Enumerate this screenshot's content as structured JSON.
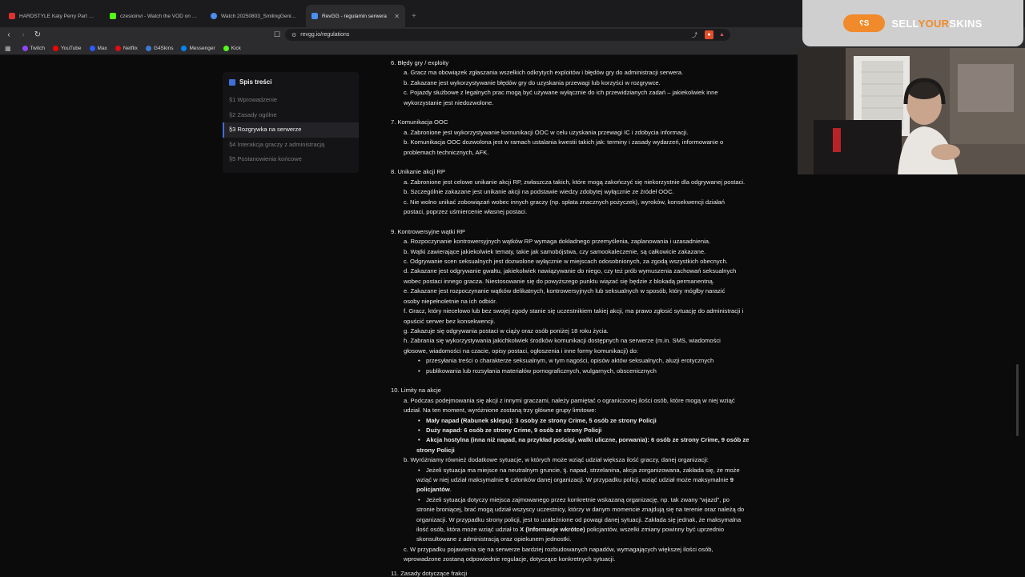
{
  "tabs": [
    {
      "title": "HARDSTYLE Katy Perry Part Of M",
      "color": "#e0302d"
    },
    {
      "title": "czesioinvi - Watch the VOD on Kick",
      "color": "#53fc18"
    },
    {
      "title": "Watch 20250803_SmilingGeniusGarl",
      "color": "#4a8ef0"
    },
    {
      "title": "RevGG - regulamin serwera",
      "color": "#4a8ef0"
    }
  ],
  "url": "revgg.io/regulations",
  "bookmarks": [
    {
      "label": "Twitch",
      "color": "#9146ff"
    },
    {
      "label": "YouTube",
      "color": "#ff0000"
    },
    {
      "label": "Max",
      "color": "#2d5bff"
    },
    {
      "label": "Netflix",
      "color": "#e50914"
    },
    {
      "label": "G4Skins",
      "color": "#3a7bd5"
    },
    {
      "label": "Messenger",
      "color": "#0084ff"
    },
    {
      "label": "Kick",
      "color": "#53fc18"
    }
  ],
  "toc": {
    "title": "Spis treści",
    "items": [
      "§1 Wprowadzenie",
      "§2 Zasady ogólne",
      "§3 Rozgrywka na serwerze",
      "§4 Interakcja graczy z administracją",
      "§5 Postanowienia końcowe"
    ],
    "active_index": 2
  },
  "content": {
    "s6": {
      "title": "6. Błędy gry / exploity",
      "a": "a. Gracz ma obowiązek zgłaszania wszelkich odkrytych exploitów i błędów gry do administracji serwera.",
      "b": "b. Zakazane jest wykorzystywanie błędów gry do uzyskania przewagi lub korzyści w rozgrywce.",
      "c1": "c. Pojazdy służbowe z legalnych prac mogą być używane wyłącznie do ich przewidzianych zadań – jakiekolwiek inne",
      "c2": "wykorzystanie jest niedozwolone."
    },
    "s7": {
      "title": "7. Komunikacja OOC",
      "a": "a. Zabronione jest wykorzystywanie komunikacji OOC w celu uzyskania przewagi IC i zdobycia informacji.",
      "b1": "b. Komunikacja OOC dozwolona jest w ramach ustalania kwestii takich jak: terminy i zasady wydarzeń, informowanie o",
      "b2": "problemach technicznych, AFK."
    },
    "s8": {
      "title": "8. Unikanie akcji RP",
      "a": "a. Zabronione jest celowe unikanie akcji RP, zwłaszcza takich, które mogą zakończyć się niekorzystnie dla odgrywanej postaci.",
      "b": "b. Szczególnie zakazane jest unikanie akcji na podstawie wiedzy zdobytej wyłącznie ze źródeł OOC.",
      "c1": "c. Nie wolno unikać zobowiązań wobec innych graczy (np. spłata znacznych pożyczek), wyroków, konsekwencji działań",
      "c2": "postaci, poprzez uśmiercenie własnej postaci."
    },
    "s9": {
      "title": "9. Kontrowersyjne wątki RP",
      "a": "a. Rozpoczynanie kontrowersyjnych wątków RP wymaga dokładnego przemyślenia, zaplanowania i uzasadnienia.",
      "b": "b. Wątki zawierające jakiekolwiek tematy, takie jak samobójstwa, czy samookaleczenie, są całkowicie zakazane.",
      "c": "c. Odgrywanie scen seksualnych jest dozwolone wyłącznie w miejscach odosobnionych, za zgodą wszystkich obecnych.",
      "d1": "d. Zakazane jest odgrywanie gwałtu, jakiekolwiek nawiązywanie do niego, czy też prób wymuszenia zachowań seksualnych",
      "d2": "wobec postaci innego gracza. Niestosowanie się do powyższego punktu wiązać się będzie z blokadą permanentną.",
      "e1": "e. Zakazane jest rozpoczynanie wątków delikatnych, kontrowersyjnych lub seksualnych w sposób, który mógłby narazić",
      "e2": "osoby niepełnoletnie na ich odbiór.",
      "f1": "f. Gracz, który niecelowo lub bez swojej zgody stanie się uczestnikiem takiej akcji, ma prawo zgłosić sytuację do administracji i",
      "f2": "opuścić serwer bez konsekwencji.",
      "g": "g. Zakazuje się odgrywania postaci w ciąży oraz osób poniżej 18 roku życia.",
      "h1": "h. Zabrania się wykorzystywania jakichkolwiek środków komunikacji dostępnych na serwerze (m.in. SMS, wiadomości",
      "h2": "głosowe, wiadomości na czacie, opisy postaci, ogłoszenia i inne formy komunikacji) do:",
      "h_b1": "przesyłania treści o charakterze seksualnym, w tym nagości, opisów aktów seksualnych, aluzji erotycznych",
      "h_b2": "publikowania lub rozsyłania materiałów pornograficznych, wulgarnych, obscenicznych"
    },
    "s10": {
      "title": "10. Limity na akcje",
      "a1": "a. Podczas podejmowania się akcji z innymi graczami, należy pamiętać o ograniczonej ilości osób, które mogą w niej wziąć",
      "a2": "udział. Na ten moment, wyróżnione zostaną trzy główne grupy limitowe:",
      "a_b1": "Mały napad (Rabunek sklepu): 3 osoby ze strony Crime, 5 osób ze strony Policji",
      "a_b2": "Duży napad: 6 osób ze strony Crime, 9 osób ze strony Policji",
      "a_b3_1": "Akcja hostylna (inna niż napad, na przykład pościgi, walki uliczne, porwania): 6 osób ze strony Crime, 9 osób ze",
      "a_b3_2": "strony Policji",
      "b": "b. Wyróżniamy również dodatkowe sytuacje, w których może wziąć udział większa ilość graczy, danej organizacji:",
      "b_b1_1": "Jeżeli sytuacja ma miejsce na neutralnym gruncie, tj. napad, strzelanina, akcja zorganizowana, zakłada się, że może",
      "b_b1_2a": "wziąć w niej udział maksymalnie ",
      "b_b1_2b": "6",
      "b_b1_2c": " członków danej organizacji. W przypadku policji, wziąć udział może maksymalnie ",
      "b_b1_2d": "9",
      "b_b1_3": "policjantów",
      "b_b1_3dot": ".",
      "b_b2_1": "Jeżeli sytuacja dotyczy miejsca zajmowanego przez konkretnie wskazaną organizację, np. tak zwany \"wjazd\", po",
      "b_b2_2": "stronie broniącej, brać mogą udział wszyscy uczestnicy, którzy w danym momencie znajdują się na terenie oraz należą do",
      "b_b2_3": "organizacji. W przypadku strony policji, jest to uzależnione od powagi danej sytuacji. Zakłada się jednak, że maksymalna",
      "b_b2_4a": "ilość osób, która może wziąć udział to ",
      "b_b2_4b": "X (Informacje wkrótce)",
      "b_b2_4c": " policjantów, wszelki zmiany powinny być uprzednio",
      "b_b2_5": "skonsultowane z administracją oraz opiekunem jednostki.",
      "c1": "c. W przypadku pojawienia się na serwerze bardziej rozbudowanych napadów, wymagających większej ilości osób,",
      "c2": "wprowadzone zostaną odpowiednie regulacje, dotyczące konkretnych sytuacji."
    },
    "s11_title": "11. Zasady dotyczące frakcji"
  },
  "sponsor": {
    "logo_text": "ʕS",
    "name_part1": "SELL",
    "name_part2": "YOUR",
    "name_part3": "SKINS"
  }
}
